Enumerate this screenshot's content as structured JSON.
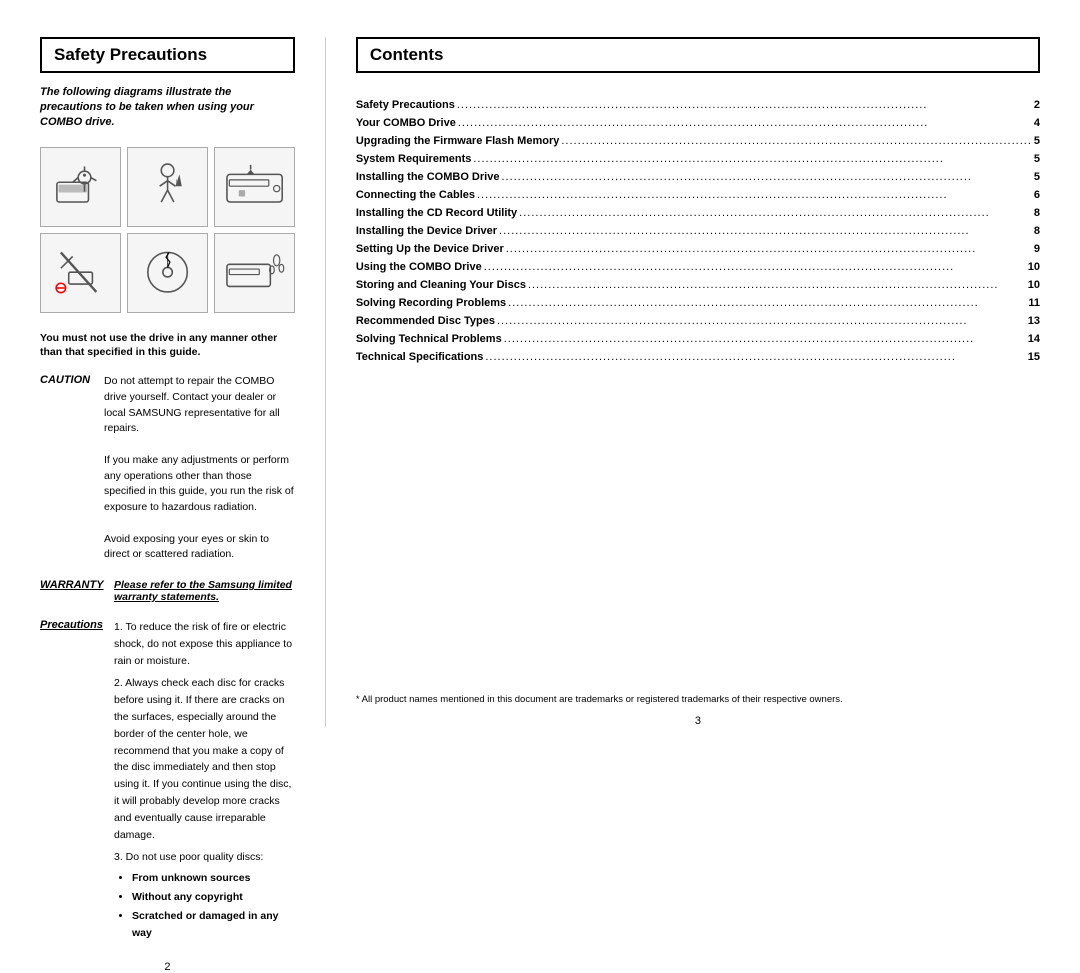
{
  "left": {
    "title": "Safety Precautions",
    "intro": "The following diagrams illustrate the precautions to be taken when using your COMBO drive.",
    "warning": "You must not use the drive in any manner other than that specified in this guide.",
    "caution": {
      "label": "CAUTION",
      "text1": "Do not attempt to repair the COMBO drive yourself. Contact your dealer or local SAMSUNG representative for all repairs.",
      "text2": "If you make any adjustments or perform any operations other than those specified in this guide, you run the risk of exposure to hazardous radiation.",
      "text3": "Avoid exposing your eyes or skin to direct or scattered radiation."
    },
    "warranty": {
      "label": "WARRANTY",
      "text": "Please refer to the Samsung limited warranty statements."
    },
    "precautions": {
      "label": "Precautions",
      "item1": "1. To reduce the risk of fire or electric shock, do not expose this appliance to rain or moisture.",
      "item2": "2. Always check each disc for cracks before using it. If there are cracks on the surfaces, especially around the border of the center hole, we recommend that you make a copy of the disc immediately and then stop using it. If you continue using the disc, it will probably develop more cracks and eventually cause irreparable damage.",
      "item3": "3. Do not use poor quality discs:",
      "bullet1": "From unknown sources",
      "bullet2": "Without any copyright",
      "bullet3": "Scratched or damaged in any way"
    },
    "page_number": "2"
  },
  "right": {
    "title": "Contents",
    "toc": [
      {
        "title": "Safety Precautions",
        "dots": "..........................................",
        "page": "2"
      },
      {
        "title": "Your COMBO Drive",
        "dots": "..........................................",
        "page": "4"
      },
      {
        "title": "Upgrading the Firmware Flash Memory",
        "dots": "...........................",
        "page": "5"
      },
      {
        "title": "System Requirements",
        "dots": "..........................................",
        "page": "5"
      },
      {
        "title": "Installing the COMBO Drive",
        "dots": "....................................",
        "page": "5"
      },
      {
        "title": "Connecting the Cables",
        "dots": "..........................................",
        "page": "6"
      },
      {
        "title": "Installing the CD Record Utility",
        "dots": "...............................",
        "page": "8"
      },
      {
        "title": "Installing the Device Driver",
        "dots": "...................................",
        "page": "8"
      },
      {
        "title": "Setting Up the Device Driver",
        "dots": "..................................",
        "page": "9"
      },
      {
        "title": "Using the COMBO Drive",
        "dots": ".........................................",
        "page": "10"
      },
      {
        "title": "Storing and Cleaning Your Discs",
        "dots": "...............................",
        "page": "10"
      },
      {
        "title": "Solving Recording Problems",
        "dots": "....................................",
        "page": "11"
      },
      {
        "title": "Recommended Disc Types",
        "dots": ".......................................",
        "page": "13"
      },
      {
        "title": "Solving Technical Problems",
        "dots": "....................................",
        "page": "14"
      },
      {
        "title": "Technical Specifications",
        "dots": ".......................................",
        "page": "15"
      }
    ],
    "footnote": "* All product names mentioned in this document are trademarks or registered trademarks of their respective owners.",
    "page_number": "3"
  }
}
